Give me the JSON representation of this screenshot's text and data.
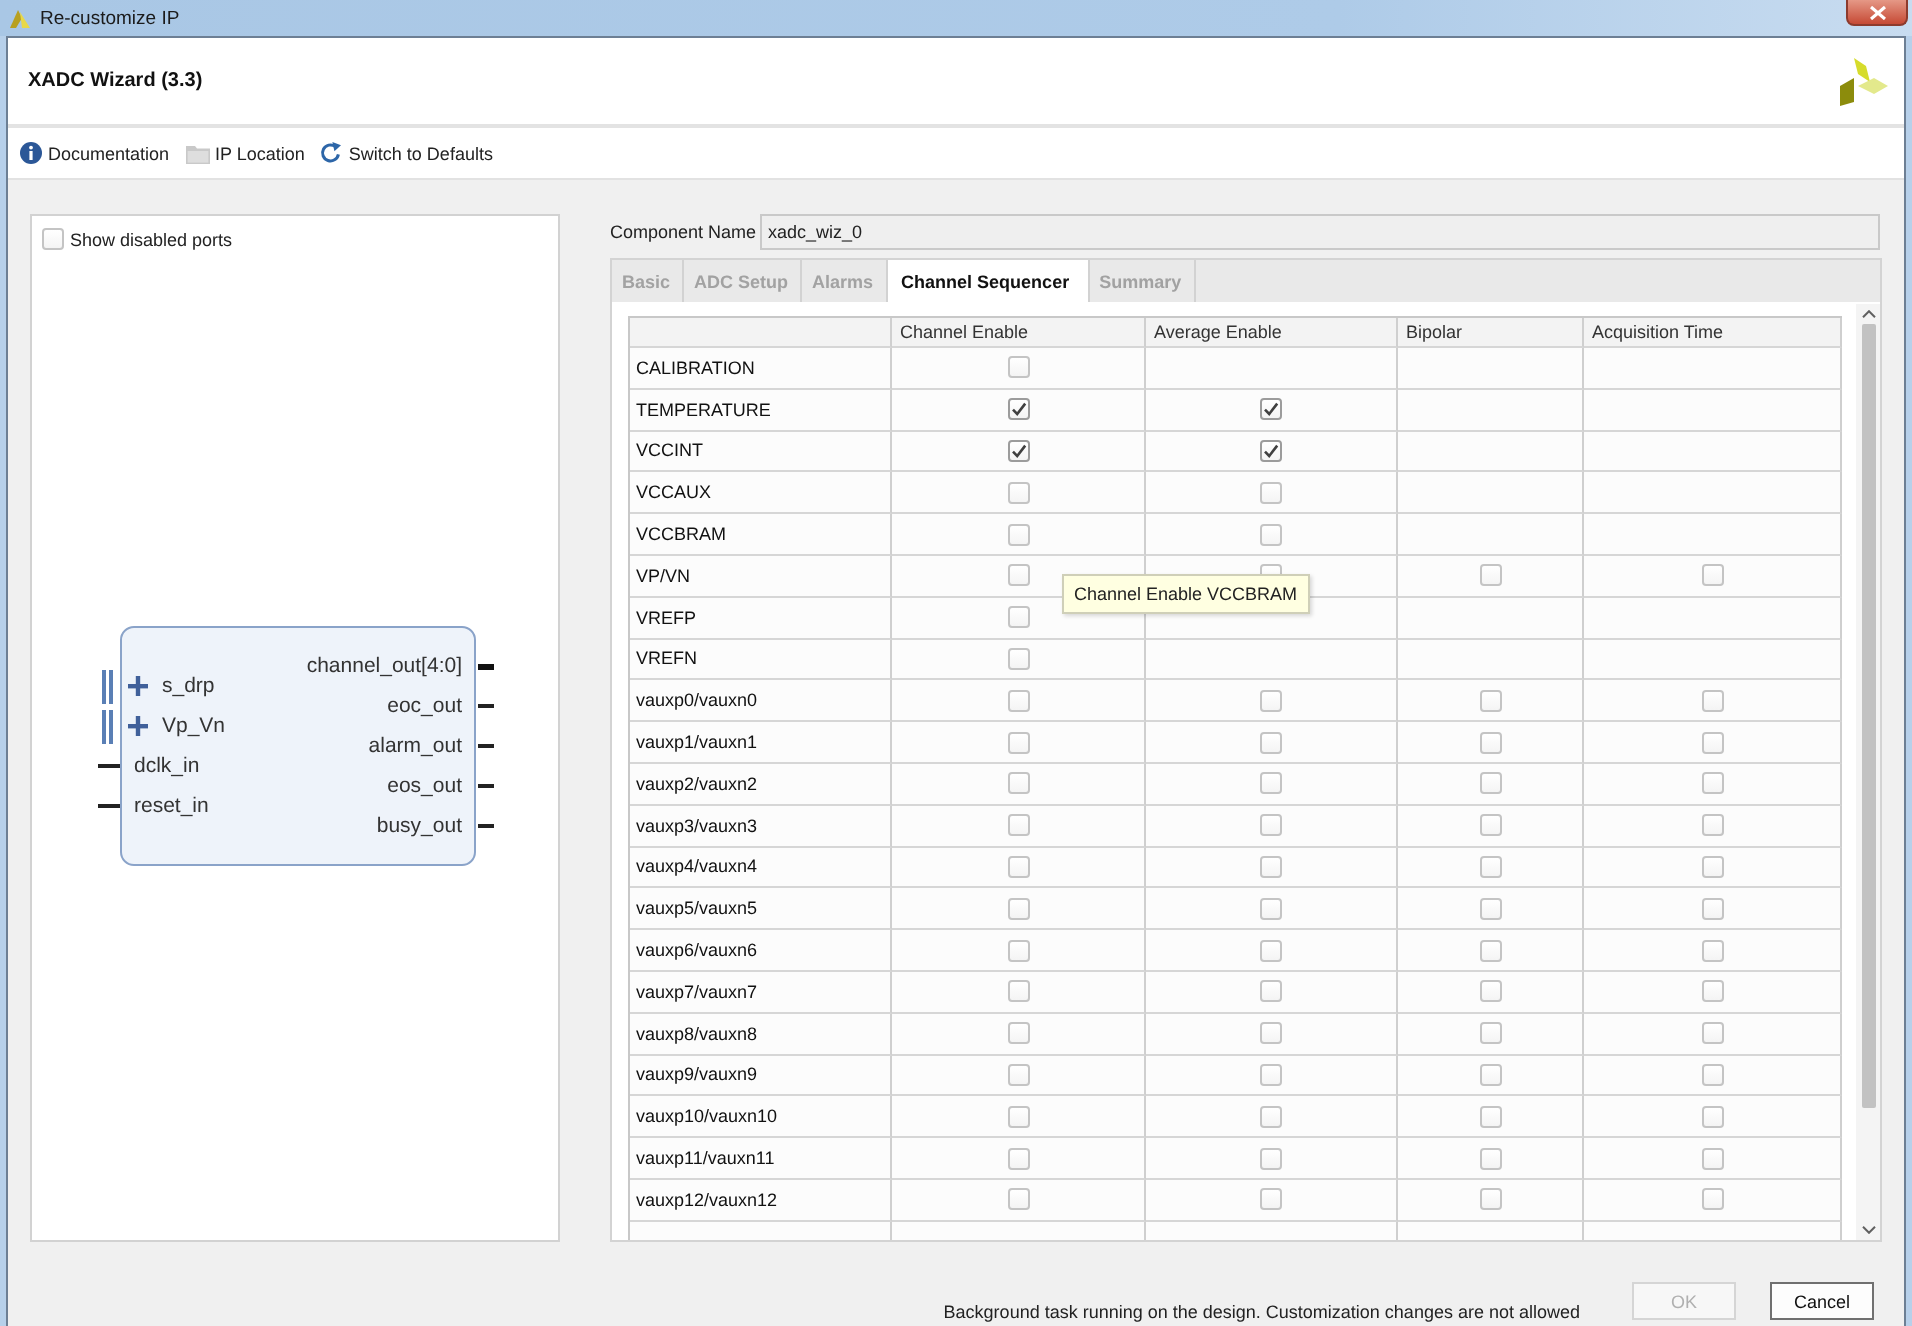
{
  "window": {
    "title": "Re-customize IP"
  },
  "header": {
    "title": "XADC Wizard (3.3)"
  },
  "toolbar": [
    {
      "label": "Documentation",
      "kind": "info"
    },
    {
      "label": "IP Location",
      "kind": "folder"
    },
    {
      "label": "Switch to Defaults",
      "kind": "reset"
    }
  ],
  "symbol_panel": {
    "show_disabled_ports": {
      "label": "Show disabled ports",
      "checked": false
    },
    "left_ports": [
      {
        "name": "s_drp",
        "kind": "interface"
      },
      {
        "name": "Vp_Vn",
        "kind": "interface"
      },
      {
        "name": "dclk_in",
        "kind": "pin"
      },
      {
        "name": "reset_in",
        "kind": "pin"
      }
    ],
    "right_ports": [
      {
        "name": "channel_out[4:0]",
        "kind": "bus"
      },
      {
        "name": "eoc_out",
        "kind": "pin"
      },
      {
        "name": "alarm_out",
        "kind": "pin"
      },
      {
        "name": "eos_out",
        "kind": "pin"
      },
      {
        "name": "busy_out",
        "kind": "pin"
      }
    ]
  },
  "component_name": {
    "label": "Component Name",
    "value": "xadc_wiz_0"
  },
  "tabs": [
    {
      "label": "Basic",
      "selected": false
    },
    {
      "label": "ADC Setup",
      "selected": false
    },
    {
      "label": "Alarms",
      "selected": false
    },
    {
      "label": "Channel Sequencer",
      "selected": true
    },
    {
      "label": "Summary",
      "selected": false
    }
  ],
  "table": {
    "columns": [
      "Channel Enable",
      "Average Enable",
      "Bipolar",
      "Acquisition Time"
    ],
    "rows": [
      {
        "name": "CALIBRATION",
        "cells": [
          {
            "kind": "checkbox",
            "checked": false
          },
          {
            "kind": "blank"
          },
          {
            "kind": "blank"
          },
          {
            "kind": "blank"
          }
        ]
      },
      {
        "name": "TEMPERATURE",
        "cells": [
          {
            "kind": "checkbox",
            "checked": true
          },
          {
            "kind": "checkbox",
            "checked": true
          },
          {
            "kind": "blank"
          },
          {
            "kind": "blank"
          }
        ]
      },
      {
        "name": "VCCINT",
        "cells": [
          {
            "kind": "checkbox",
            "checked": true
          },
          {
            "kind": "checkbox",
            "checked": true
          },
          {
            "kind": "blank"
          },
          {
            "kind": "blank"
          }
        ]
      },
      {
        "name": "VCCAUX",
        "cells": [
          {
            "kind": "checkbox",
            "checked": false
          },
          {
            "kind": "checkbox",
            "checked": false
          },
          {
            "kind": "blank"
          },
          {
            "kind": "blank"
          }
        ]
      },
      {
        "name": "VCCBRAM",
        "cells": [
          {
            "kind": "checkbox",
            "checked": false
          },
          {
            "kind": "checkbox",
            "checked": false
          },
          {
            "kind": "blank"
          },
          {
            "kind": "blank"
          }
        ]
      },
      {
        "name": "VP/VN",
        "cells": [
          {
            "kind": "checkbox",
            "checked": false
          },
          {
            "kind": "checkbox",
            "checked": false
          },
          {
            "kind": "checkbox",
            "checked": false
          },
          {
            "kind": "checkbox",
            "checked": false
          }
        ]
      },
      {
        "name": "VREFP",
        "cells": [
          {
            "kind": "checkbox",
            "checked": false
          },
          {
            "kind": "blank"
          },
          {
            "kind": "blank"
          },
          {
            "kind": "blank"
          }
        ]
      },
      {
        "name": "VREFN",
        "cells": [
          {
            "kind": "checkbox",
            "checked": false
          },
          {
            "kind": "blank"
          },
          {
            "kind": "blank"
          },
          {
            "kind": "blank"
          }
        ]
      },
      {
        "name": "vauxp0/vauxn0",
        "cells": [
          {
            "kind": "checkbox",
            "checked": false
          },
          {
            "kind": "checkbox",
            "checked": false
          },
          {
            "kind": "checkbox",
            "checked": false
          },
          {
            "kind": "checkbox",
            "checked": false
          }
        ]
      },
      {
        "name": "vauxp1/vauxn1",
        "cells": [
          {
            "kind": "checkbox",
            "checked": false
          },
          {
            "kind": "checkbox",
            "checked": false
          },
          {
            "kind": "checkbox",
            "checked": false
          },
          {
            "kind": "checkbox",
            "checked": false
          }
        ]
      },
      {
        "name": "vauxp2/vauxn2",
        "cells": [
          {
            "kind": "checkbox",
            "checked": false
          },
          {
            "kind": "checkbox",
            "checked": false
          },
          {
            "kind": "checkbox",
            "checked": false
          },
          {
            "kind": "checkbox",
            "checked": false
          }
        ]
      },
      {
        "name": "vauxp3/vauxn3",
        "cells": [
          {
            "kind": "checkbox",
            "checked": false
          },
          {
            "kind": "checkbox",
            "checked": false
          },
          {
            "kind": "checkbox",
            "checked": false
          },
          {
            "kind": "checkbox",
            "checked": false
          }
        ]
      },
      {
        "name": "vauxp4/vauxn4",
        "cells": [
          {
            "kind": "checkbox",
            "checked": false
          },
          {
            "kind": "checkbox",
            "checked": false
          },
          {
            "kind": "checkbox",
            "checked": false
          },
          {
            "kind": "checkbox",
            "checked": false
          }
        ]
      },
      {
        "name": "vauxp5/vauxn5",
        "cells": [
          {
            "kind": "checkbox",
            "checked": false
          },
          {
            "kind": "checkbox",
            "checked": false
          },
          {
            "kind": "checkbox",
            "checked": false
          },
          {
            "kind": "checkbox",
            "checked": false
          }
        ]
      },
      {
        "name": "vauxp6/vauxn6",
        "cells": [
          {
            "kind": "checkbox",
            "checked": false
          },
          {
            "kind": "checkbox",
            "checked": false
          },
          {
            "kind": "checkbox",
            "checked": false
          },
          {
            "kind": "checkbox",
            "checked": false
          }
        ]
      },
      {
        "name": "vauxp7/vauxn7",
        "cells": [
          {
            "kind": "checkbox",
            "checked": false
          },
          {
            "kind": "checkbox",
            "checked": false
          },
          {
            "kind": "checkbox",
            "checked": false
          },
          {
            "kind": "checkbox",
            "checked": false
          }
        ]
      },
      {
        "name": "vauxp8/vauxn8",
        "cells": [
          {
            "kind": "checkbox",
            "checked": false
          },
          {
            "kind": "checkbox",
            "checked": false
          },
          {
            "kind": "checkbox",
            "checked": false
          },
          {
            "kind": "checkbox",
            "checked": false
          }
        ]
      },
      {
        "name": "vauxp9/vauxn9",
        "cells": [
          {
            "kind": "checkbox",
            "checked": false
          },
          {
            "kind": "checkbox",
            "checked": false
          },
          {
            "kind": "checkbox",
            "checked": false
          },
          {
            "kind": "checkbox",
            "checked": false
          }
        ]
      },
      {
        "name": "vauxp10/vauxn10",
        "cells": [
          {
            "kind": "checkbox",
            "checked": false
          },
          {
            "kind": "checkbox",
            "checked": false
          },
          {
            "kind": "checkbox",
            "checked": false
          },
          {
            "kind": "checkbox",
            "checked": false
          }
        ]
      },
      {
        "name": "vauxp11/vauxn11",
        "cells": [
          {
            "kind": "checkbox",
            "checked": false
          },
          {
            "kind": "checkbox",
            "checked": false
          },
          {
            "kind": "checkbox",
            "checked": false
          },
          {
            "kind": "checkbox",
            "checked": false
          }
        ]
      },
      {
        "name": "vauxp12/vauxn12",
        "cells": [
          {
            "kind": "checkbox",
            "checked": false
          },
          {
            "kind": "checkbox",
            "checked": false
          },
          {
            "kind": "checkbox",
            "checked": false
          },
          {
            "kind": "checkbox",
            "checked": false
          }
        ]
      }
    ]
  },
  "tooltip": "Channel Enable VCCBRAM",
  "status_message": "Background task running on the design. Customization changes are not allowed",
  "buttons": [
    {
      "label": "OK",
      "disabled": true
    },
    {
      "label": "Cancel",
      "disabled": false
    }
  ]
}
